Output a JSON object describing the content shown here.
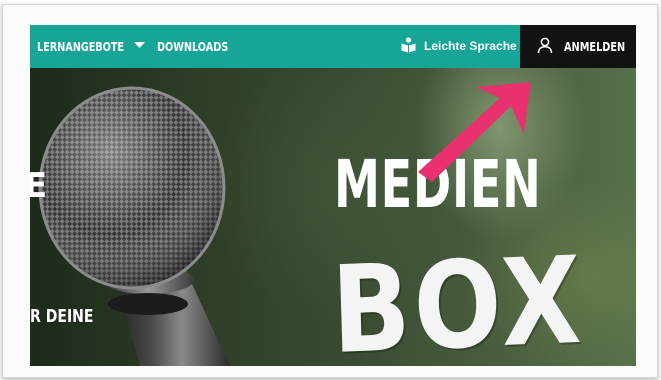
{
  "nav": {
    "lernangebote_label": "LERNANGEBOTE",
    "downloads_label": "DOWNLOADS",
    "leichte_sprache_label": "Leichte Sprache",
    "login_label": "ANMELDEN"
  },
  "hero": {
    "title_line1": "MEDIEN",
    "title_line2": "BOX",
    "left_partial_letter": "E",
    "left_partial_text": "R DEINE"
  },
  "icons": {
    "dropdown": "chevron-down-icon",
    "leichte_sprache": "book-reader-icon",
    "login": "user-icon",
    "annotation": "arrow-icon"
  },
  "colors": {
    "nav_bg": "#16a596",
    "login_bg": "#0f1312",
    "annotation_arrow": "#e8316e"
  }
}
